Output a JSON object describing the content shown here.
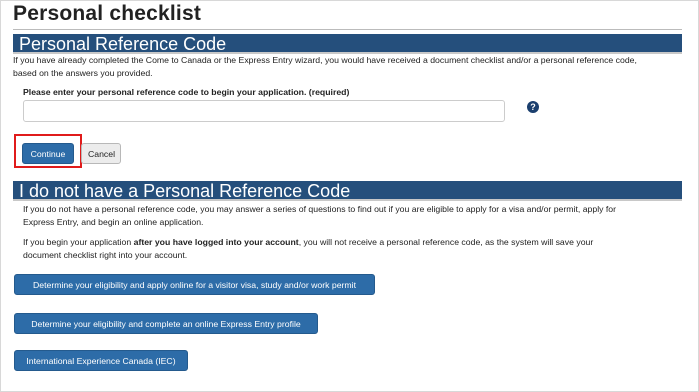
{
  "page": {
    "title": "Personal checklist"
  },
  "reference_section": {
    "heading": "Personal Reference Code",
    "intro_line1": "If you have already completed the Come to Canada or the Express Entry wizard, you would have received a document checklist and/or a personal reference code,",
    "intro_line2": "based on the answers you provided.",
    "input_label": "Please enter your personal reference code to begin your application. (required)",
    "input_value": "",
    "help_icon_glyph": "?",
    "continue_label": "Continue",
    "cancel_label": "Cancel"
  },
  "no_code_section": {
    "heading": "I do not have a Personal Reference Code",
    "para1_line1": "If you do not have a personal reference code, you may answer a series of questions to find out if you are eligible to apply for a visa and/or permit, apply for",
    "para1_line2": "Express Entry, and begin an online application.",
    "para2_line1_pre": "If you begin your application ",
    "para2_line1_bold": "after you have logged into your account",
    "para2_line1_post": ", you will not receive a personal reference code, as the system will save your",
    "para2_line2": "document checklist right into your account.",
    "buttons": [
      {
        "label": "Determine your eligibility and apply online for a visitor visa, study and/or work permit"
      },
      {
        "label": "Determine your eligibility and complete an online Express Entry profile"
      },
      {
        "label": "International Experience Canada (IEC)"
      }
    ]
  },
  "colors": {
    "banner": "#254f7c",
    "primary_button": "#2d6ca8",
    "highlight": "#e01b1b",
    "help_icon": "#1b3f6e"
  }
}
